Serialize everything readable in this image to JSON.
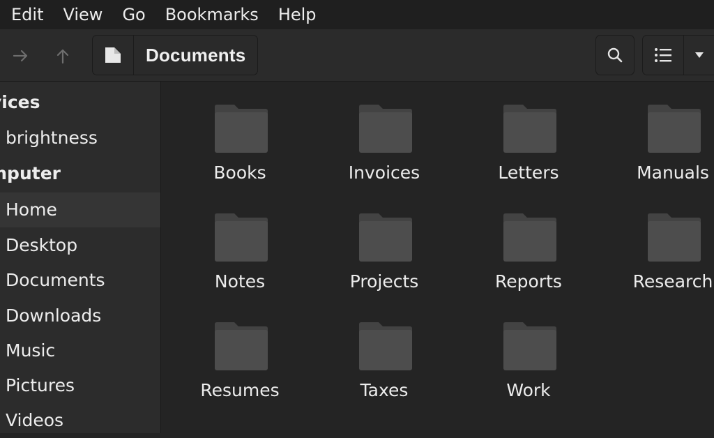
{
  "menu": [
    "Edit",
    "View",
    "Go",
    "Bookmarks",
    "Help"
  ],
  "path": {
    "current": "Documents"
  },
  "sidebar": {
    "items": [
      {
        "label": "vices",
        "type": "header"
      },
      {
        "label": "brightness",
        "type": "item"
      },
      {
        "label": "mputer",
        "type": "header"
      },
      {
        "label": "Home",
        "type": "item",
        "selected": true
      },
      {
        "label": "Desktop",
        "type": "item"
      },
      {
        "label": "Documents",
        "type": "item"
      },
      {
        "label": "Downloads",
        "type": "item"
      },
      {
        "label": "Music",
        "type": "item"
      },
      {
        "label": "Pictures",
        "type": "item"
      },
      {
        "label": "Videos",
        "type": "item"
      }
    ]
  },
  "folders": [
    "Books",
    "Invoices",
    "Letters",
    "Manuals",
    "Notes",
    "Projects",
    "Reports",
    "Research",
    "Resumes",
    "Taxes",
    "Work"
  ],
  "colors": {
    "folder": "#4d4d4d",
    "folder_tab": "#434343",
    "background": "#242424",
    "sidebar": "#2c2c2c",
    "selected": "#353535"
  }
}
